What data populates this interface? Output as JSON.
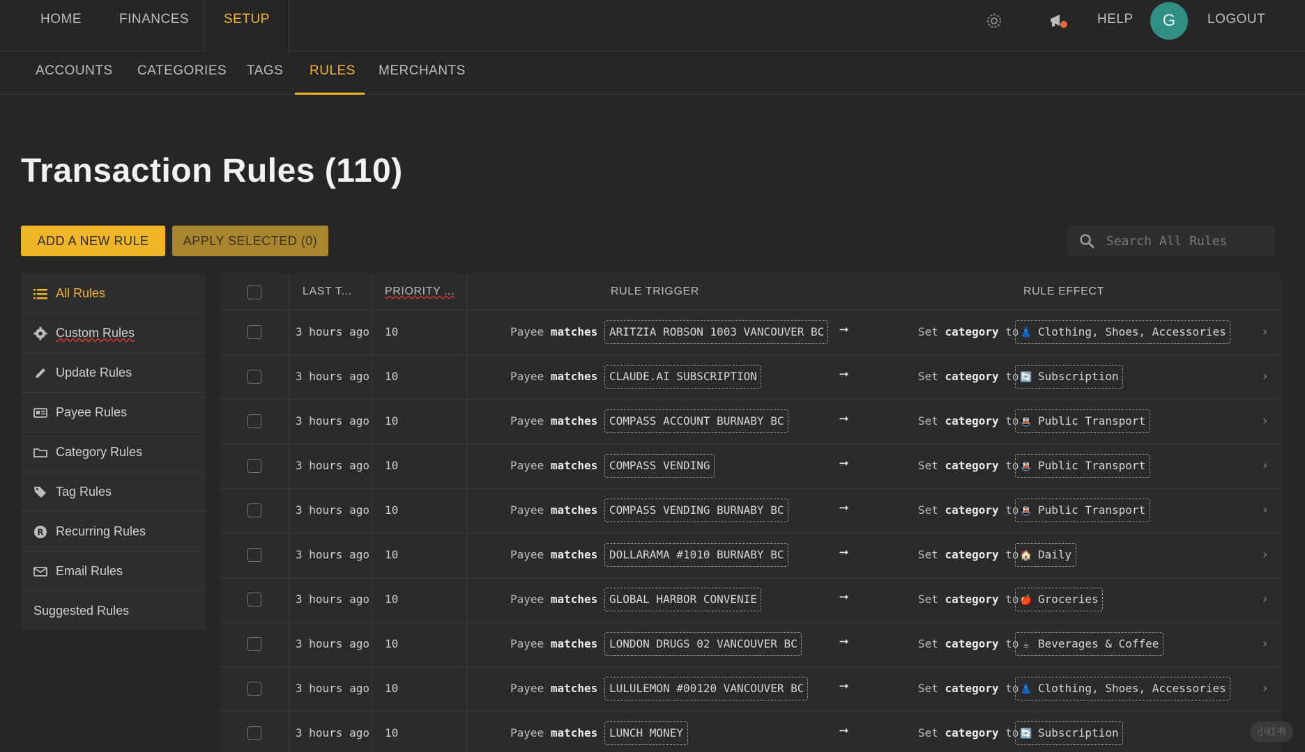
{
  "topnav": {
    "items": [
      "HOME",
      "FINANCES",
      "SETUP"
    ],
    "help": "HELP",
    "logout": "LOGOUT",
    "avatar_letter": "G"
  },
  "subnav": {
    "items": [
      "ACCOUNTS",
      "CATEGORIES",
      "TAGS",
      "RULES",
      "MERCHANTS"
    ]
  },
  "page": {
    "title": "Transaction Rules (110)",
    "add_button": "ADD A NEW RULE",
    "apply_button": "APPLY SELECTED (0)",
    "search_placeholder": "Search All Rules"
  },
  "sidebar": {
    "items": [
      {
        "label": "All Rules",
        "icon": "list-icon"
      },
      {
        "label": "Custom Rules",
        "icon": "gear-icon"
      },
      {
        "label": "Update Rules",
        "icon": "pencil-icon"
      },
      {
        "label": "Payee Rules",
        "icon": "id-card-icon"
      },
      {
        "label": "Category Rules",
        "icon": "folder-icon"
      },
      {
        "label": "Tag Rules",
        "icon": "tag-icon"
      },
      {
        "label": "Recurring Rules",
        "icon": "recurring-icon"
      },
      {
        "label": "Email Rules",
        "icon": "envelope-icon"
      },
      {
        "label": "Suggested Rules",
        "icon": ""
      }
    ]
  },
  "table": {
    "headers": [
      "LAST T...",
      "PRIORITY ...",
      "RULE TRIGGER",
      "RULE EFFECT"
    ],
    "payee_word": "Payee",
    "matches_word": "matches",
    "set_word": "Set",
    "category_word": "category",
    "to_word": "to",
    "rows": [
      {
        "last": "3 hours ago",
        "priority": "10",
        "trigger": "ARITZIA ROBSON 1003 VANCOUVER BC",
        "effect": "Clothing, Shoes, Accessories",
        "emoji": "👗"
      },
      {
        "last": "3 hours ago",
        "priority": "10",
        "trigger": "CLAUDE.AI SUBSCRIPTION",
        "effect": "Subscription",
        "emoji": "🔄"
      },
      {
        "last": "3 hours ago",
        "priority": "10",
        "trigger": "COMPASS ACCOUNT BURNABY BC",
        "effect": "Public Transport",
        "emoji": "🚇"
      },
      {
        "last": "3 hours ago",
        "priority": "10",
        "trigger": "COMPASS VENDING",
        "effect": "Public Transport",
        "emoji": "🚇"
      },
      {
        "last": "3 hours ago",
        "priority": "10",
        "trigger": "COMPASS VENDING BURNABY BC",
        "effect": "Public Transport",
        "emoji": "🚇"
      },
      {
        "last": "3 hours ago",
        "priority": "10",
        "trigger": "DOLLARAMA #1010 BURNABY BC",
        "effect": "Daily",
        "emoji": "🏠"
      },
      {
        "last": "3 hours ago",
        "priority": "10",
        "trigger": "GLOBAL HARBOR CONVENIE",
        "effect": "Groceries",
        "emoji": "🍎"
      },
      {
        "last": "3 hours ago",
        "priority": "10",
        "trigger": "LONDON DRUGS 02 VANCOUVER BC",
        "effect": "Beverages & Coffee",
        "emoji": "☕"
      },
      {
        "last": "3 hours ago",
        "priority": "10",
        "trigger": "LULULEMON #00120 VANCOUVER BC",
        "effect": "Clothing, Shoes, Accessories",
        "emoji": "👗"
      },
      {
        "last": "3 hours ago",
        "priority": "10",
        "trigger": "LUNCH MONEY",
        "effect": "Subscription",
        "emoji": "🔄"
      }
    ]
  },
  "colors": {
    "accent": "#f0b429",
    "background": "#262626",
    "avatar": "#2f8f83"
  },
  "watermark": "小红书"
}
